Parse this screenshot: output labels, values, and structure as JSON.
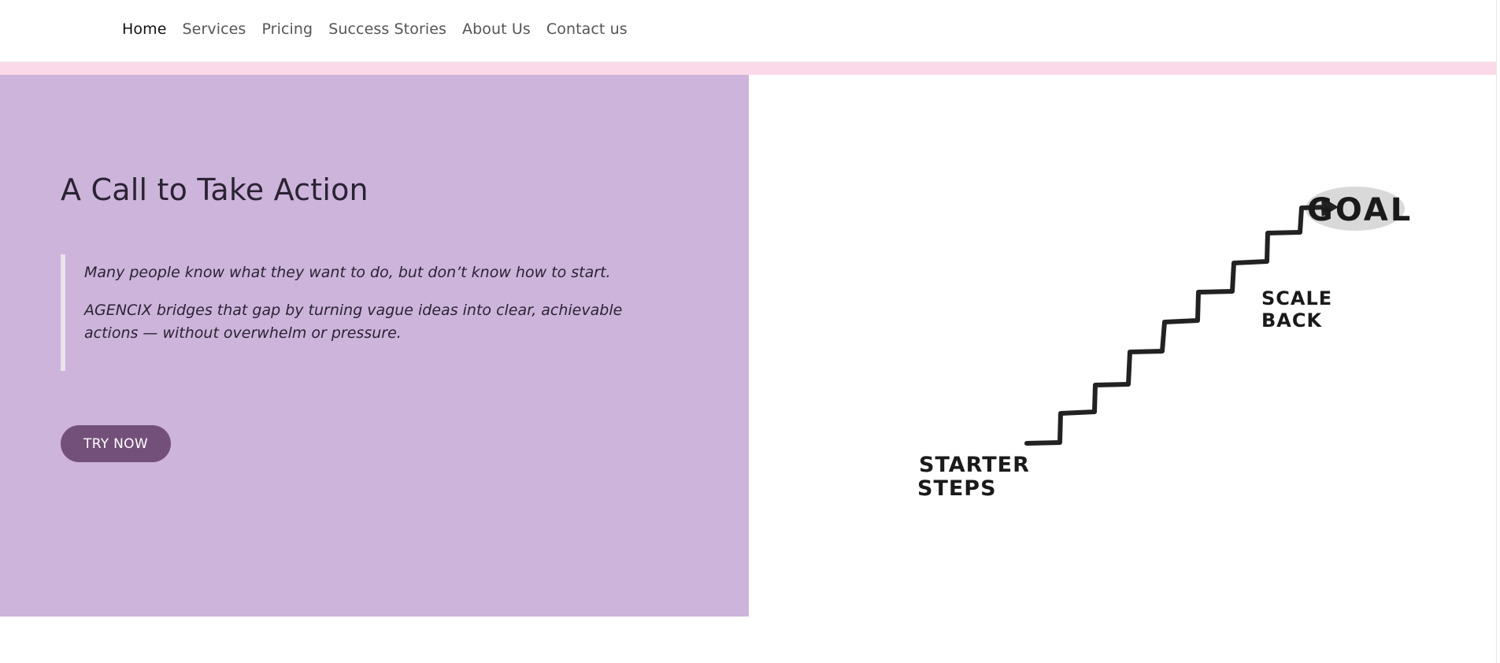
{
  "nav": {
    "items": [
      {
        "label": "Home",
        "active": true
      },
      {
        "label": "Services",
        "active": false
      },
      {
        "label": "Pricing",
        "active": false
      },
      {
        "label": "Success Stories",
        "active": false
      },
      {
        "label": "About Us",
        "active": false
      },
      {
        "label": "Contact us",
        "active": false
      }
    ]
  },
  "hero": {
    "title": "A Call to Take Action",
    "quote_line_1": "Many people know what they want to do, but don’t know how to start.",
    "quote_line_2": "AGENCIX bridges that gap by turning vague ideas into clear, achievable actions — without overwhelm or pressure.",
    "cta_label": "TRY NOW"
  },
  "illustration": {
    "goal_label": "GOAL",
    "scale_back_line_1": "SCALE",
    "scale_back_line_2": "BACK",
    "starter_steps_line_1": "STARTER",
    "starter_steps_line_2": "STEPS"
  },
  "colors": {
    "hero_background": "#cdb4db",
    "accent_strip": "#fbd9e8",
    "cta_background": "#73507a",
    "text_dark": "#2a2333"
  }
}
